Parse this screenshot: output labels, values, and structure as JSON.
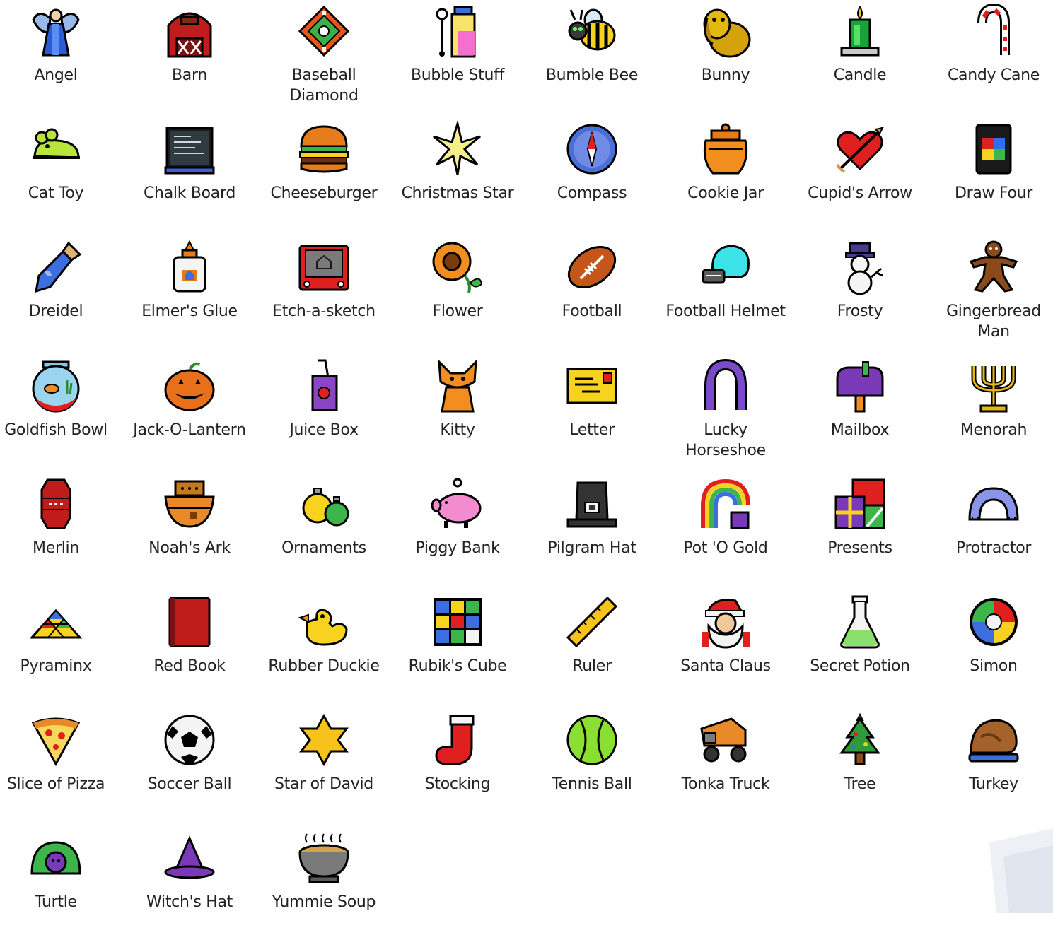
{
  "icons": [
    {
      "label": "Angel",
      "icon": "angel-icon"
    },
    {
      "label": "Barn",
      "icon": "barn-icon"
    },
    {
      "label": "Baseball Diamond",
      "icon": "baseball-diamond-icon"
    },
    {
      "label": "Bubble Stuff",
      "icon": "bubble-stuff-icon"
    },
    {
      "label": "Bumble Bee",
      "icon": "bumble-bee-icon"
    },
    {
      "label": "Bunny",
      "icon": "bunny-icon"
    },
    {
      "label": "Candle",
      "icon": "candle-icon"
    },
    {
      "label": "Candy Cane",
      "icon": "candy-cane-icon"
    },
    {
      "label": "Cat Toy",
      "icon": "cat-toy-icon"
    },
    {
      "label": "Chalk Board",
      "icon": "chalk-board-icon"
    },
    {
      "label": "Cheeseburger",
      "icon": "cheeseburger-icon"
    },
    {
      "label": "Christmas Star",
      "icon": "christmas-star-icon"
    },
    {
      "label": "Compass",
      "icon": "compass-icon"
    },
    {
      "label": "Cookie Jar",
      "icon": "cookie-jar-icon"
    },
    {
      "label": "Cupid's Arrow",
      "icon": "cupids-arrow-icon"
    },
    {
      "label": "Draw Four",
      "icon": "draw-four-icon"
    },
    {
      "label": "Dreidel",
      "icon": "dreidel-icon"
    },
    {
      "label": "Elmer's Glue",
      "icon": "elmers-glue-icon"
    },
    {
      "label": "Etch-a-sketch",
      "icon": "etch-a-sketch-icon"
    },
    {
      "label": "Flower",
      "icon": "flower-icon"
    },
    {
      "label": "Football",
      "icon": "football-icon"
    },
    {
      "label": "Football Helmet",
      "icon": "football-helmet-icon"
    },
    {
      "label": "Frosty",
      "icon": "frosty-icon"
    },
    {
      "label": "Gingerbread Man",
      "icon": "gingerbread-man-icon"
    },
    {
      "label": "Goldfish Bowl",
      "icon": "goldfish-bowl-icon"
    },
    {
      "label": "Jack-O-Lantern",
      "icon": "jack-o-lantern-icon"
    },
    {
      "label": "Juice Box",
      "icon": "juice-box-icon"
    },
    {
      "label": "Kitty",
      "icon": "kitty-icon"
    },
    {
      "label": "Letter",
      "icon": "letter-icon"
    },
    {
      "label": "Lucky Horseshoe",
      "icon": "lucky-horseshoe-icon"
    },
    {
      "label": "Mailbox",
      "icon": "mailbox-icon"
    },
    {
      "label": "Menorah",
      "icon": "menorah-icon"
    },
    {
      "label": "Merlin",
      "icon": "merlin-icon"
    },
    {
      "label": "Noah's Ark",
      "icon": "noahs-ark-icon"
    },
    {
      "label": "Ornaments",
      "icon": "ornaments-icon"
    },
    {
      "label": "Piggy Bank",
      "icon": "piggy-bank-icon"
    },
    {
      "label": "Pilgram Hat",
      "icon": "pilgram-hat-icon"
    },
    {
      "label": "Pot 'O Gold",
      "icon": "pot-o-gold-icon"
    },
    {
      "label": "Presents",
      "icon": "presents-icon"
    },
    {
      "label": "Protractor",
      "icon": "protractor-icon"
    },
    {
      "label": "Pyraminx",
      "icon": "pyraminx-icon"
    },
    {
      "label": "Red Book",
      "icon": "red-book-icon"
    },
    {
      "label": "Rubber Duckie",
      "icon": "rubber-duckie-icon"
    },
    {
      "label": "Rubik's Cube",
      "icon": "rubiks-cube-icon"
    },
    {
      "label": "Ruler",
      "icon": "ruler-icon"
    },
    {
      "label": "Santa Claus",
      "icon": "santa-claus-icon"
    },
    {
      "label": "Secret Potion",
      "icon": "secret-potion-icon"
    },
    {
      "label": "Simon",
      "icon": "simon-icon"
    },
    {
      "label": "Slice of Pizza",
      "icon": "slice-of-pizza-icon"
    },
    {
      "label": "Soccer Ball",
      "icon": "soccer-ball-icon"
    },
    {
      "label": "Star of David",
      "icon": "star-of-david-icon"
    },
    {
      "label": "Stocking",
      "icon": "stocking-icon"
    },
    {
      "label": "Tennis Ball",
      "icon": "tennis-ball-icon"
    },
    {
      "label": "Tonka Truck",
      "icon": "tonka-truck-icon"
    },
    {
      "label": "Tree",
      "icon": "tree-icon"
    },
    {
      "label": "Turkey",
      "icon": "turkey-icon"
    },
    {
      "label": "Turtle",
      "icon": "turtle-icon"
    },
    {
      "label": "Witch's Hat",
      "icon": "witchs-hat-icon"
    },
    {
      "label": "Yummie Soup",
      "icon": "yummie-soup-icon"
    }
  ]
}
